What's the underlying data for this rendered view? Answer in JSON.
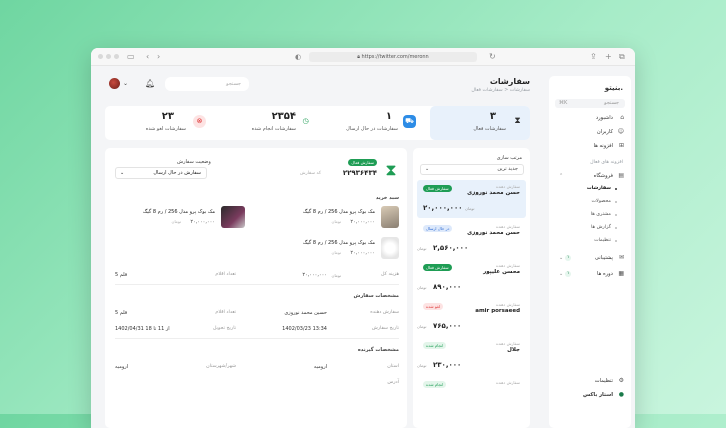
{
  "browser": {
    "url": "https://twitter.com/meronn"
  },
  "sidebar": {
    "brand": "بنیتو.",
    "search_placeholder": "جستجو",
    "shortcut": "⌘K",
    "items": [
      {
        "label": "داشبورد"
      },
      {
        "label": "کاربران"
      },
      {
        "label": "افزونه ها"
      }
    ],
    "section": "افزونه های فعال",
    "store": {
      "label": "فروشگاه",
      "subs": [
        "سفارشات",
        "محصولات",
        "مشتری ها",
        "گزارش ها",
        "تنظیمات"
      ]
    },
    "support": {
      "label": "پشتیبانی",
      "badge": "۱"
    },
    "courses": {
      "label": "دوره ها",
      "badge": "۱"
    },
    "settings": "تنظیمات",
    "footer_brand": "استار باکس"
  },
  "header": {
    "title": "سفارشات",
    "breadcrumb": "سفارشات  <  سفارشات فعال",
    "search_placeholder": "جستجو"
  },
  "stats": [
    {
      "value": "۳",
      "label": "سفارشات فعال"
    },
    {
      "value": "۱",
      "label": "سفارشات در حال ارسال"
    },
    {
      "value": "۲۳۵۴",
      "label": "سفارشات انجام شده"
    },
    {
      "value": "۲۳",
      "label": "سفارشات لغو شده"
    }
  ],
  "orders": {
    "sort_label": "مرتب سازی",
    "sort_value": "جدید ترین",
    "caption": "سفارش دهنده",
    "unit": "تومان",
    "items": [
      {
        "name": "حسن محمد نوروزی",
        "status": "سفارش فعال",
        "price": "۲۰,۰۰۰,۰۰۰"
      },
      {
        "name": "حسن محمد نوروزی",
        "status": "در حال ارسال",
        "price": "۲,۵۶۰,۰۰۰"
      },
      {
        "name": "محسن علیپور",
        "status": "سفارش فعال",
        "price": "۸۹۰,۰۰۰"
      },
      {
        "name": "amir porsaeed",
        "status": "لغو شده",
        "price": "۷۶۵,۰۰۰"
      },
      {
        "name": "جلال",
        "status": "انجام شده",
        "price": "۲۳۰,۰۰۰"
      },
      {
        "name": "",
        "status": "انجام شده",
        "price": ""
      }
    ]
  },
  "detail": {
    "status_tag": "سفارش فعال",
    "code": "۲۲۹۳۶۴۳۴",
    "code_label": "کد سفارش",
    "status_label": "وضعیت سفارش",
    "status_value": "سفارش در حال ارسال",
    "cart_title": "سبد خرید",
    "products": [
      {
        "name": "مک بوک پرو مدل 256 / رم 8 گیگ",
        "price": "۲۰,۰۰۰,۰۰۰",
        "unit": "تومان"
      },
      {
        "name": "مک بوک پرو مدل 256 / رم 8 گیگ",
        "price": "۲۰,۰۰۰,۰۰۰",
        "unit": "تومان"
      },
      {
        "name": "مک بوک پرو مدل 256 / رم 8 گیگ",
        "price": "۲۰,۰۰۰,۰۰۰",
        "unit": "تومان"
      }
    ],
    "total_label": "هزینه کل",
    "total_value": "۲۰,۰۰۰,۰۰۰",
    "total_unit": "تومان",
    "count_label": "تعداد اقلام",
    "count_value": "5 قلم",
    "order_info_title": "مشخصات سفارش",
    "orderer_label": "سفارش دهنده",
    "orderer_value": "حسین محمد نوروزی",
    "items_label": "تعداد اقلام",
    "items_value": "5 قلم",
    "date_label": "تاریخ سفارش",
    "date_value": "1402/03/23 13:34",
    "delivery_label": "تاریخ تحویل",
    "delivery_value": "1402/04/31  از 11 تا 18",
    "receiver_title": "مشخصات گیرنده",
    "province_label": "استان",
    "province_value": "ارومیه",
    "city_label": "شهر/شهرستان",
    "city_value": "ارومیه",
    "address_label": "آدرس"
  }
}
